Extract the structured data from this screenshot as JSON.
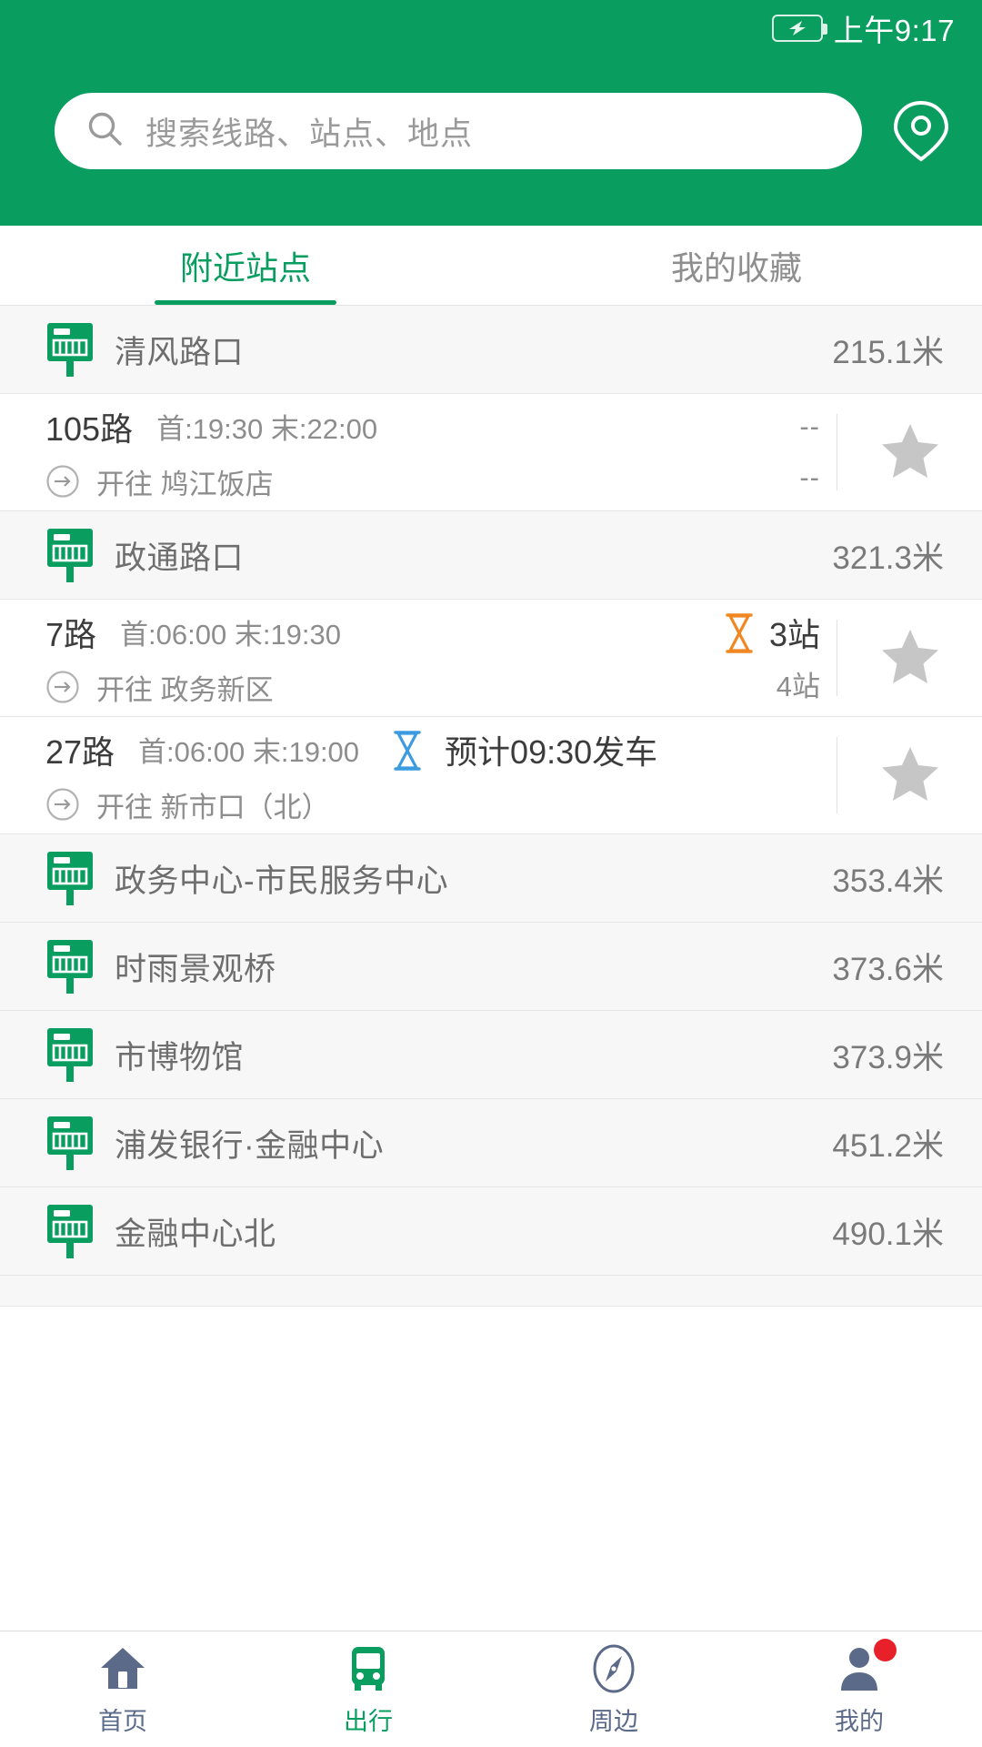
{
  "colors": {
    "brand_green": "#0a9d60",
    "accent_orange": "#f08722",
    "accent_blue": "#3d9be0",
    "nav_inactive": "#5b6a89",
    "badge_red": "#e8202a"
  },
  "status_bar": {
    "time": "上午9:17",
    "battery_icon": "battery-charging-icon"
  },
  "search": {
    "placeholder": "搜索线路、站点、地点",
    "search_icon": "search-icon",
    "map_pin_icon": "map-pin-icon"
  },
  "tabs": [
    {
      "label": "附近站点",
      "active": true
    },
    {
      "label": "我的收藏",
      "active": false
    }
  ],
  "list": [
    {
      "type": "station",
      "icon": "bus-stop-sign-icon",
      "name": "清风路口",
      "distance": "215.1米"
    },
    {
      "type": "route",
      "number": "105路",
      "times": "首:19:30  末:22:00",
      "dest_prefix": "开往",
      "dest": "鸠江饭店",
      "arrow_icon": "arrow-right-circle-icon",
      "eta_primary": "--",
      "eta_primary_style": "dash",
      "eta_secondary": "--",
      "eta_icon": null,
      "star_icon": "star-icon",
      "starred": false
    },
    {
      "type": "station",
      "icon": "bus-stop-sign-icon",
      "name": "政通路口",
      "distance": "321.3米"
    },
    {
      "type": "route",
      "number": "7路",
      "times": "首:06:00  末:19:30",
      "dest_prefix": "开往",
      "dest": "政务新区",
      "arrow_icon": "arrow-right-circle-icon",
      "eta_primary": "3站",
      "eta_primary_style": "normal",
      "eta_secondary": "4站",
      "eta_icon": "hourglass-icon-orange",
      "star_icon": "star-icon",
      "starred": false
    },
    {
      "type": "route",
      "number": "27路",
      "times": "首:06:00  末:19:00",
      "dest_prefix": "开往",
      "dest": "新市口（北）",
      "arrow_icon": "arrow-right-circle-icon",
      "eta_primary": "预计09:30发车",
      "eta_primary_style": "normal",
      "eta_secondary": "",
      "eta_icon": "hourglass-icon-blue",
      "star_icon": "star-icon",
      "starred": false
    },
    {
      "type": "station",
      "icon": "bus-stop-sign-icon",
      "name": "政务中心-市民服务中心",
      "distance": "353.4米"
    },
    {
      "type": "station",
      "icon": "bus-stop-sign-icon",
      "name": "时雨景观桥",
      "distance": "373.6米"
    },
    {
      "type": "station",
      "icon": "bus-stop-sign-icon",
      "name": "市博物馆",
      "distance": "373.9米"
    },
    {
      "type": "station",
      "icon": "bus-stop-sign-icon",
      "name": "浦发银行·金融中心",
      "distance": "451.2米"
    },
    {
      "type": "station",
      "icon": "bus-stop-sign-icon",
      "name": "金融中心北",
      "distance": "490.1米"
    }
  ],
  "bottom_nav": [
    {
      "label": "首页",
      "icon": "home-icon",
      "active": false,
      "badge": false
    },
    {
      "label": "出行",
      "icon": "bus-icon",
      "active": true,
      "badge": false
    },
    {
      "label": "周边",
      "icon": "compass-icon",
      "active": false,
      "badge": false
    },
    {
      "label": "我的",
      "icon": "person-icon",
      "active": false,
      "badge": true
    }
  ]
}
